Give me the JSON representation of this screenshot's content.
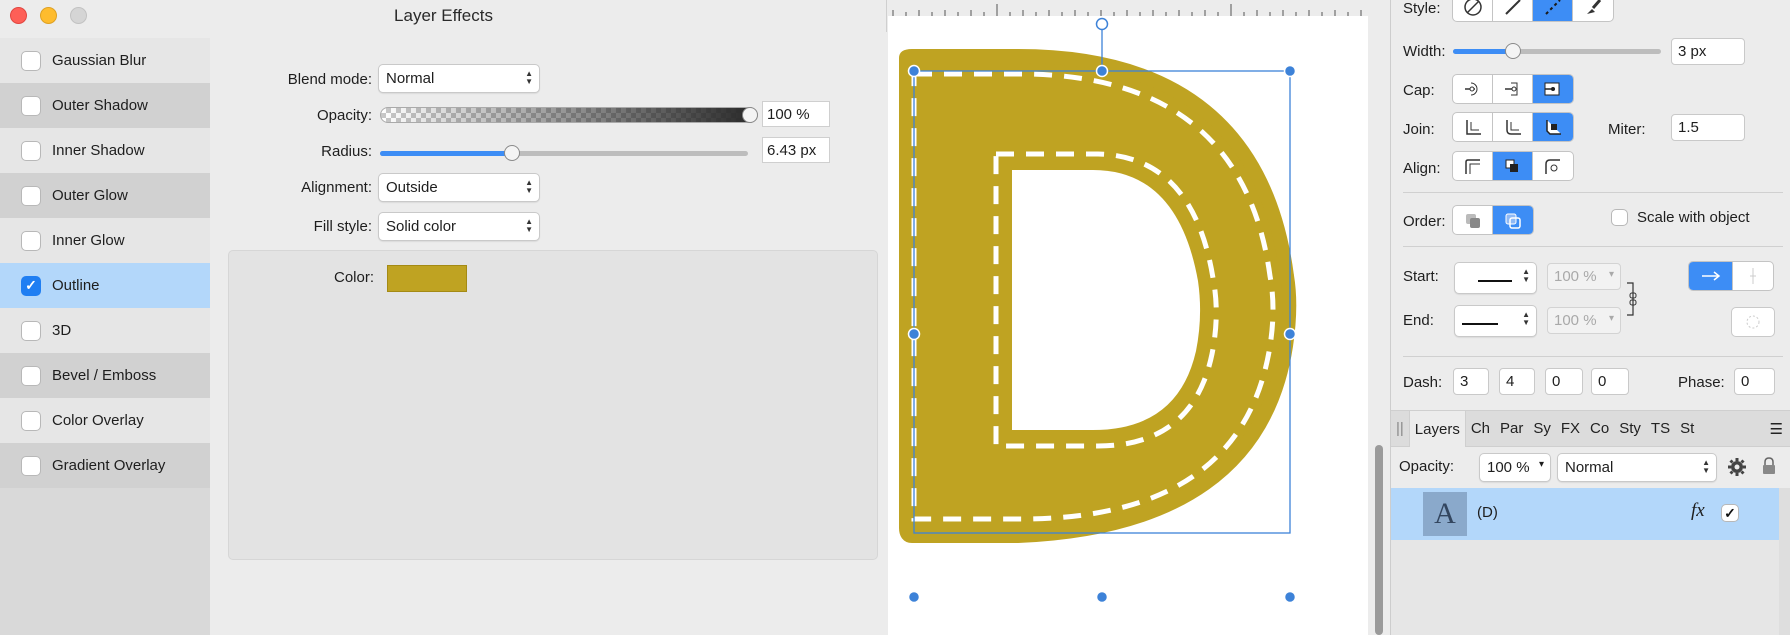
{
  "dialog": {
    "title": "Layer Effects",
    "effects": [
      {
        "label": "Gaussian Blur",
        "checked": false
      },
      {
        "label": "Outer Shadow",
        "checked": false
      },
      {
        "label": "Inner Shadow",
        "checked": false
      },
      {
        "label": "Outer Glow",
        "checked": false
      },
      {
        "label": "Inner Glow",
        "checked": false
      },
      {
        "label": "Outline",
        "checked": true
      },
      {
        "label": "3D",
        "checked": false
      },
      {
        "label": "Bevel / Emboss",
        "checked": false
      },
      {
        "label": "Color Overlay",
        "checked": false
      },
      {
        "label": "Gradient Overlay",
        "checked": false
      }
    ],
    "selected_effect": "Outline",
    "blend_mode": {
      "label": "Blend mode:",
      "value": "Normal"
    },
    "opacity": {
      "label": "Opacity:",
      "value": "100 %",
      "fraction": 1.0
    },
    "radius": {
      "label": "Radius:",
      "value": "6.43 px",
      "fraction": 0.36
    },
    "alignment": {
      "label": "Alignment:",
      "value": "Outside"
    },
    "fill_style": {
      "label": "Fill style:",
      "value": "Solid color"
    },
    "color": {
      "label": "Color:",
      "hex": "#bfa322"
    }
  },
  "canvas": {
    "glyph": "D",
    "fill_color": "#bfa322",
    "selection_color": "#3d82d8"
  },
  "stroke_panel": {
    "style": {
      "label": "Style:",
      "selected": "dashed-line-icon"
    },
    "width": {
      "label": "Width:",
      "value": "3 px",
      "fraction": 0.29
    },
    "cap": {
      "label": "Cap:",
      "selected_index": 2
    },
    "join": {
      "label": "Join:",
      "selected_index": 2
    },
    "miter": {
      "label": "Miter:",
      "value": "1.5"
    },
    "align": {
      "label": "Align:",
      "selected_index": 1
    },
    "order": {
      "label": "Order:",
      "selected_index": 1
    },
    "scale_with_object": {
      "label": "Scale with object",
      "checked": false
    },
    "start": {
      "label": "Start:",
      "percent": "100 %"
    },
    "end": {
      "label": "End:",
      "percent": "100 %"
    },
    "dash": {
      "label": "Dash:",
      "values": [
        "3",
        "4",
        "0",
        "0"
      ]
    },
    "phase": {
      "label": "Phase:",
      "value": "0"
    }
  },
  "layers_panel": {
    "tabs": [
      "Layers",
      "Ch",
      "Par",
      "Sy",
      "FX",
      "Co",
      "Sty",
      "TS",
      "St"
    ],
    "active_tab": "Layers",
    "opacity": {
      "label": "Opacity:",
      "value": "100 %"
    },
    "blend": "Normal",
    "layers": [
      {
        "thumb_letter": "A",
        "name": "(D)",
        "fx_label": "fx",
        "visible": true
      }
    ]
  },
  "colors": {
    "accent": "#3d8df5",
    "selection_row": "#b3d7fa",
    "outline_yellow": "#bfa322"
  }
}
